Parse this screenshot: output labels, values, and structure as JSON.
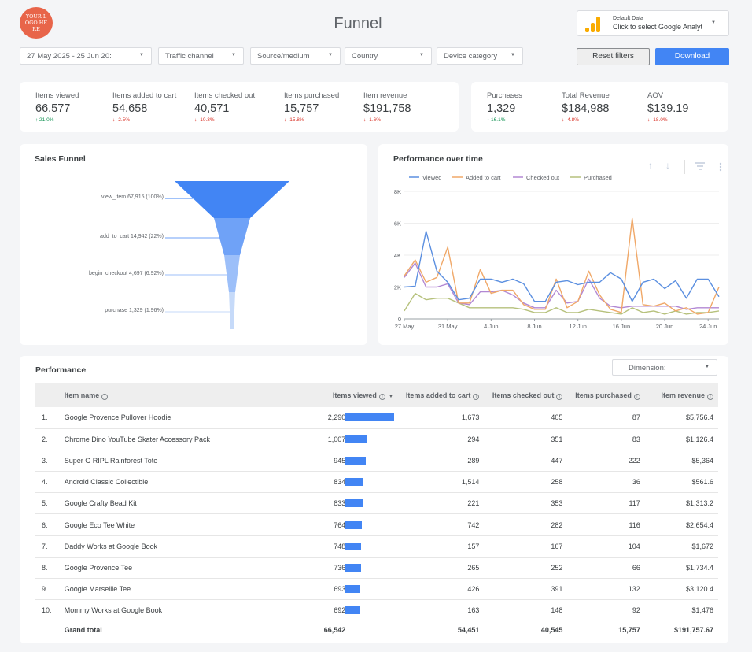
{
  "header": {
    "logo_text": "YOUR LOGO HERE",
    "title": "Funnel",
    "data_source": {
      "line1": "Default Data",
      "line2": "Click to select Google Analyt"
    }
  },
  "filters": {
    "date_range": "27 May 2025 - 25 Jun 20:",
    "traffic_channel": "Traffic channel",
    "source_medium": "Source/medium",
    "country": "Country",
    "device_category": "Device category",
    "reset_label": "Reset filters",
    "download_label": "Download"
  },
  "kpis": [
    {
      "label": "Items viewed",
      "value": "66,577",
      "change": "↑ 21.0%",
      "dir": "up"
    },
    {
      "label": "Items added to cart",
      "value": "54,658",
      "change": "↓ -2.5%",
      "dir": "down"
    },
    {
      "label": "Items checked out",
      "value": "40,571",
      "change": "↓ -10.3%",
      "dir": "down"
    },
    {
      "label": "Items purchased",
      "value": "15,757",
      "change": "↓ -15.8%",
      "dir": "down"
    },
    {
      "label": "Item revenue",
      "value": "$191,758",
      "change": "↓ -1.6%",
      "dir": "down"
    }
  ],
  "kpis2": [
    {
      "label": "Purchases",
      "value": "1,329",
      "change": "↑ 16.1%",
      "dir": "up"
    },
    {
      "label": "Total Revenue",
      "value": "$184,988",
      "change": "↓ -4.8%",
      "dir": "down"
    },
    {
      "label": "AOV",
      "value": "$139.19",
      "change": "↓ -18.0%",
      "dir": "down"
    }
  ],
  "sales_funnel": {
    "title": "Sales Funnel",
    "stages": [
      {
        "label": "view_item 67,915 (100%)",
        "value": 67915
      },
      {
        "label": "add_to_cart 14,942 (22%)",
        "value": 14942
      },
      {
        "label": "begin_checkout 4,697 (6.92%)",
        "value": 4697
      },
      {
        "label": "purchase 1,329 (1.96%)",
        "value": 1329
      }
    ],
    "colors": [
      "#4285f4",
      "#6fa2f7",
      "#9cbff9",
      "#c6daf9"
    ]
  },
  "chart_data": {
    "type": "line",
    "title": "Performance over time",
    "x": [
      "27 May",
      "28 May",
      "29 May",
      "30 May",
      "31 May",
      "1 Jun",
      "2 Jun",
      "3 Jun",
      "4 Jun",
      "5 Jun",
      "6 Jun",
      "7 Jun",
      "8 Jun",
      "9 Jun",
      "10 Jun",
      "11 Jun",
      "12 Jun",
      "13 Jun",
      "14 Jun",
      "15 Jun",
      "16 Jun",
      "17 Jun",
      "18 Jun",
      "19 Jun",
      "20 Jun",
      "21 Jun",
      "22 Jun",
      "23 Jun",
      "24 Jun",
      "25 Jun"
    ],
    "x_tick_labels": [
      "27 May",
      "31 May",
      "4 Jun",
      "8 Jun",
      "12 Jun",
      "16 Jun",
      "20 Jun",
      "24 Jun"
    ],
    "x_tick_indices": [
      0,
      4,
      8,
      12,
      16,
      20,
      24,
      28
    ],
    "y_tick_labels": [
      "0",
      "2K",
      "4K",
      "6K",
      "8K"
    ],
    "ylim": [
      0,
      8000
    ],
    "grid": true,
    "legend_position": "top",
    "series": [
      {
        "name": "Viewed",
        "color": "#5b8fe0",
        "values": [
          2000,
          2050,
          5500,
          3000,
          2300,
          1200,
          1300,
          2500,
          2500,
          2300,
          2500,
          2200,
          1100,
          1100,
          2300,
          2400,
          2150,
          2300,
          2300,
          2900,
          2500,
          1100,
          2300,
          2500,
          1900,
          2400,
          1300,
          2500,
          2500,
          1400
        ]
      },
      {
        "name": "Added to cart",
        "color": "#f0a868",
        "values": [
          2700,
          3700,
          2300,
          2600,
          4500,
          1000,
          1000,
          3100,
          1600,
          1800,
          1800,
          900,
          600,
          600,
          2500,
          700,
          1100,
          3000,
          1500,
          600,
          400,
          6300,
          900,
          800,
          1000,
          500,
          700,
          300,
          400,
          2000
        ]
      },
      {
        "name": "Checked out",
        "color": "#b288d3",
        "values": [
          2600,
          3500,
          2000,
          2000,
          2200,
          1000,
          900,
          1700,
          1700,
          1800,
          1500,
          1000,
          700,
          700,
          1800,
          1000,
          1100,
          2500,
          1300,
          800,
          700,
          800,
          800,
          800,
          800,
          800,
          600,
          700,
          700,
          700
        ]
      },
      {
        "name": "Purchased",
        "color": "#b6c17c",
        "values": [
          500,
          1600,
          1200,
          1300,
          1300,
          1000,
          700,
          700,
          700,
          700,
          700,
          600,
          400,
          400,
          700,
          400,
          400,
          600,
          500,
          400,
          300,
          700,
          400,
          500,
          300,
          500,
          300,
          400,
          400,
          500
        ]
      }
    ]
  },
  "performance": {
    "title": "Performance",
    "dimension_label": "Dimension:",
    "columns": [
      "Item name",
      "Items viewed",
      "Items added to cart",
      "Items checked out",
      "Items purchased",
      "Item revenue"
    ],
    "rows": [
      {
        "idx": "1.",
        "name": "Google Provence Pullover Hoodie",
        "viewed": "2,290",
        "viewed_num": 2290,
        "cart": "1,673",
        "checkout": "405",
        "purchased": "87",
        "revenue": "$5,756.4"
      },
      {
        "idx": "2.",
        "name": "Chrome Dino YouTube Skater Accessory Pack",
        "viewed": "1,007",
        "viewed_num": 1007,
        "cart": "294",
        "checkout": "351",
        "purchased": "83",
        "revenue": "$1,126.4"
      },
      {
        "idx": "3.",
        "name": "Super G RIPL Rainforest Tote",
        "viewed": "945",
        "viewed_num": 945,
        "cart": "289",
        "checkout": "447",
        "purchased": "222",
        "revenue": "$5,364"
      },
      {
        "idx": "4.",
        "name": "Android Classic Collectible",
        "viewed": "834",
        "viewed_num": 834,
        "cart": "1,514",
        "checkout": "258",
        "purchased": "36",
        "revenue": "$561.6"
      },
      {
        "idx": "5.",
        "name": "Google Crafty Bead Kit",
        "viewed": "833",
        "viewed_num": 833,
        "cart": "221",
        "checkout": "353",
        "purchased": "117",
        "revenue": "$1,313.2"
      },
      {
        "idx": "6.",
        "name": "Google Eco Tee White",
        "viewed": "764",
        "viewed_num": 764,
        "cart": "742",
        "checkout": "282",
        "purchased": "116",
        "revenue": "$2,654.4"
      },
      {
        "idx": "7.",
        "name": "Daddy Works at Google Book",
        "viewed": "748",
        "viewed_num": 748,
        "cart": "157",
        "checkout": "167",
        "purchased": "104",
        "revenue": "$1,672"
      },
      {
        "idx": "8.",
        "name": "Google Provence Tee",
        "viewed": "736",
        "viewed_num": 736,
        "cart": "265",
        "checkout": "252",
        "purchased": "66",
        "revenue": "$1,734.4"
      },
      {
        "idx": "9.",
        "name": "Google Marseille Tee",
        "viewed": "693",
        "viewed_num": 693,
        "cart": "426",
        "checkout": "391",
        "purchased": "132",
        "revenue": "$3,120.4"
      },
      {
        "idx": "10.",
        "name": "Mommy Works at Google Book",
        "viewed": "692",
        "viewed_num": 692,
        "cart": "163",
        "checkout": "148",
        "purchased": "92",
        "revenue": "$1,476"
      }
    ],
    "total": {
      "label": "Grand total",
      "viewed": "66,542",
      "cart": "54,451",
      "checkout": "40,545",
      "purchased": "15,757",
      "revenue": "$191,757.67"
    }
  }
}
